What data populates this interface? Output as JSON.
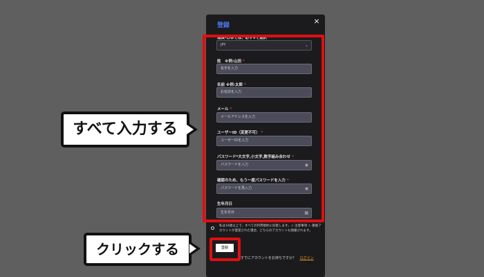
{
  "modal": {
    "title": "登録",
    "close_icon": "×",
    "fields": [
      {
        "label": "通貨-日本では、必ず¥で選択",
        "value": "JPY",
        "placeholder": "",
        "trail": "⌄",
        "type": "select"
      },
      {
        "label": "姓　※例:山田",
        "value": "",
        "placeholder": "名字を入力",
        "trail": "",
        "type": "text"
      },
      {
        "label": "名前 ※例:太郎",
        "value": "",
        "placeholder": "お名前を入力",
        "trail": "",
        "type": "text"
      },
      {
        "label": "メール",
        "value": "",
        "placeholder": "メールアドレスを入力",
        "trail": "",
        "type": "text"
      },
      {
        "label": "ユーザーID（変更不可）",
        "value": "",
        "placeholder": "ユーザーIDを入力",
        "trail": "",
        "type": "text"
      },
      {
        "label": "パスワード*大文字,小文字,数字組み合わせ",
        "value": "",
        "placeholder": "パスワードを入力",
        "trail": "◉",
        "type": "password"
      },
      {
        "label": "確認のため、もう一度パスワードを入力",
        "value": "",
        "placeholder": "パスワードを再入力",
        "trail": "◉",
        "type": "password"
      },
      {
        "label": "生年月日",
        "value": "",
        "placeholder": "生年月日",
        "trail": "▦",
        "type": "date"
      }
    ],
    "agreement": "私は18歳以上で、すべての利用規約に同意します。⚠ 注意事項 ⚠ 重複アカウントが発覚された場合、どちらのアカウントも閉鎖されます。",
    "register_label": "登録",
    "login_prompt": "すでにアカウントをお持ちですか？",
    "login_link": "ログイン"
  },
  "callouts": {
    "fill_all": "すべて入力する",
    "click": "クリックする"
  },
  "colors": {
    "background": "#5f5f5f",
    "modal": "#1b1b1e",
    "field": "#4b4b59",
    "highlight": "#e10f0f",
    "accent_title": "#4d7bf3",
    "link": "#f5a623"
  }
}
